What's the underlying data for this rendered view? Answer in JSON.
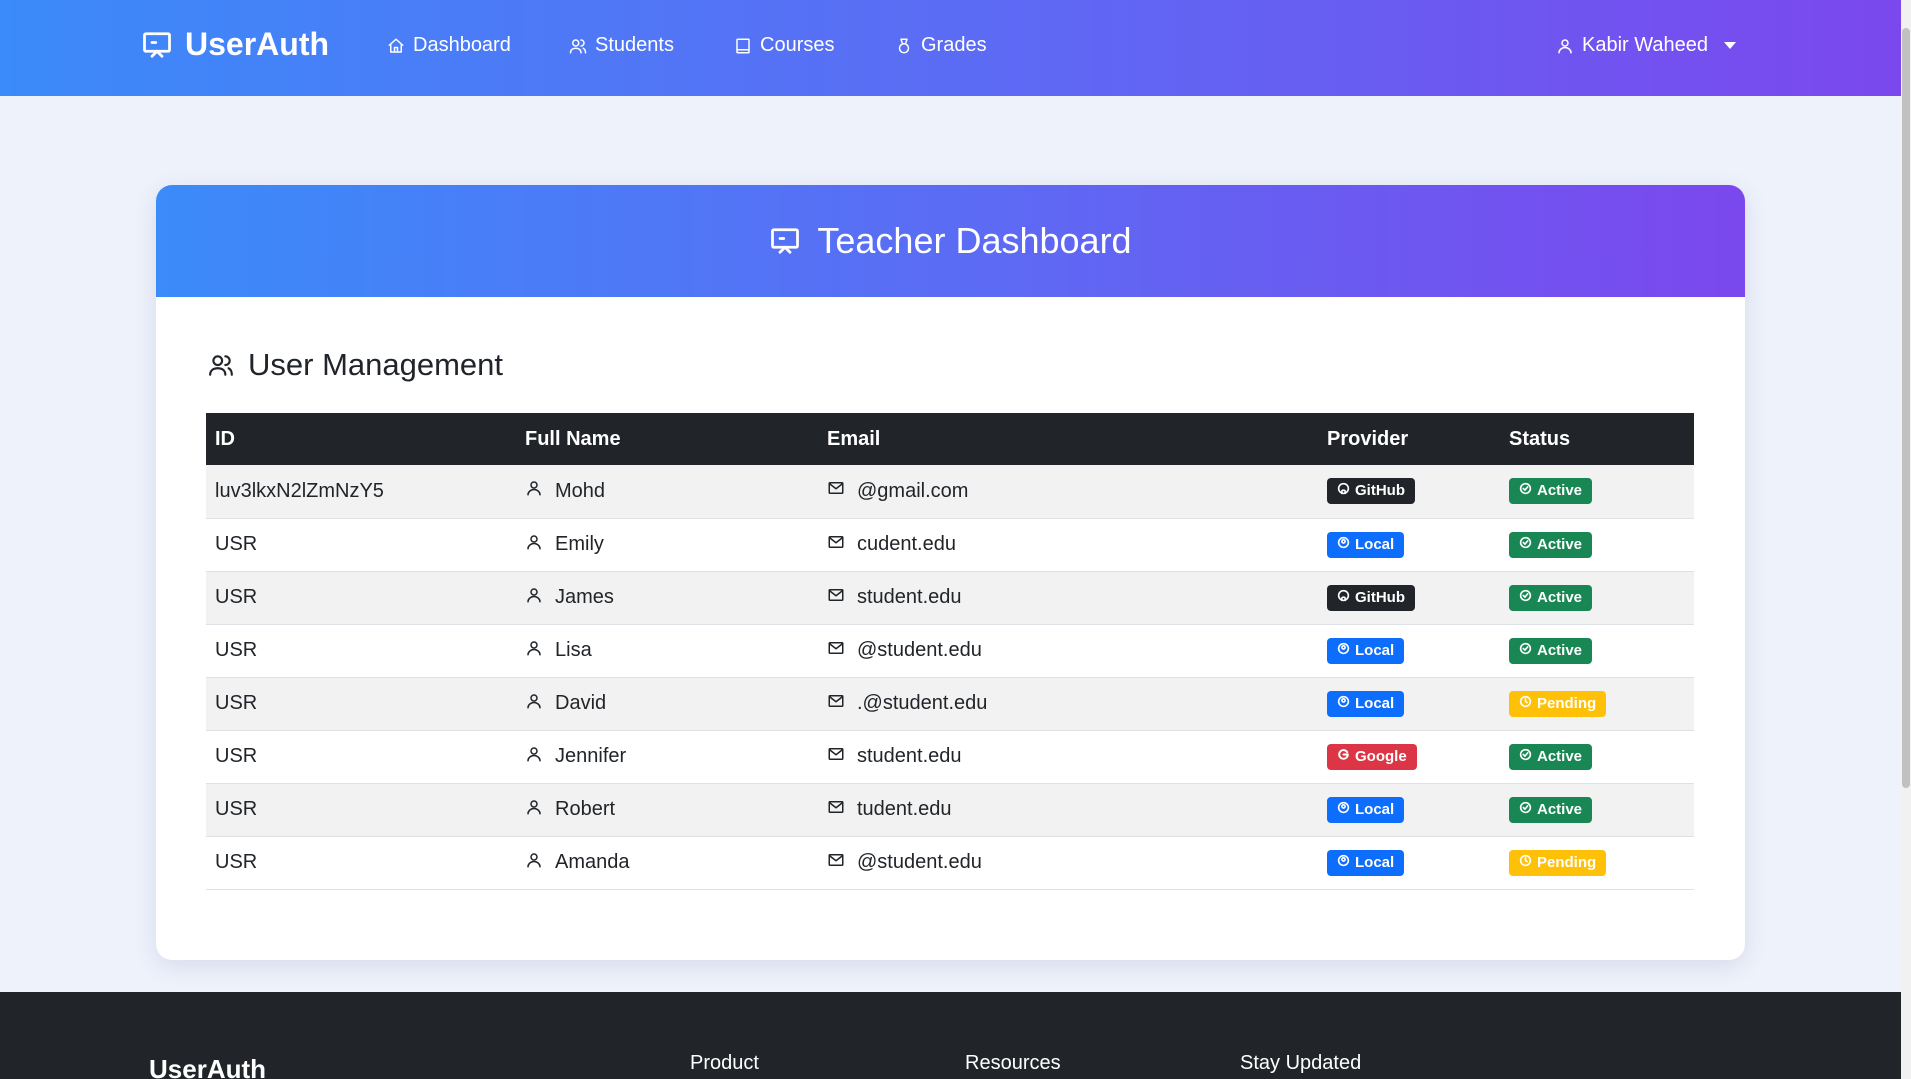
{
  "navbar": {
    "brand": "UserAuth",
    "links": [
      {
        "label": "Dashboard",
        "icon": "home-icon"
      },
      {
        "label": "Students",
        "icon": "users-icon"
      },
      {
        "label": "Courses",
        "icon": "book-icon"
      },
      {
        "label": "Grades",
        "icon": "medal-icon"
      }
    ],
    "user_name": "Kabir Waheed"
  },
  "card": {
    "title": "Teacher Dashboard",
    "section_title": "User Management"
  },
  "table": {
    "headers": [
      "ID",
      "Full Name",
      "Email",
      "Provider",
      "Status"
    ],
    "rows": [
      {
        "id": "luv3lkxN2lZmNzY5",
        "name": "Mohd",
        "email": "@gmail.com",
        "provider": "GitHub",
        "status": "Active"
      },
      {
        "id": "USR",
        "name": "Emily",
        "email": "cudent.edu",
        "provider": "Local",
        "status": "Active"
      },
      {
        "id": "USR",
        "name": "James",
        "email": "student.edu",
        "provider": "GitHub",
        "status": "Active"
      },
      {
        "id": "USR",
        "name": "Lisa",
        "email": "@student.edu",
        "provider": "Local",
        "status": "Active"
      },
      {
        "id": "USR",
        "name": "David",
        "email": ".@student.edu",
        "provider": "Local",
        "status": "Pending"
      },
      {
        "id": "USR",
        "name": "Jennifer",
        "email": "student.edu",
        "provider": "Google",
        "status": "Active"
      },
      {
        "id": "USR",
        "name": "Robert",
        "email": "tudent.edu",
        "provider": "Local",
        "status": "Active"
      },
      {
        "id": "USR",
        "name": "Amanda",
        "email": "@student.edu",
        "provider": "Local",
        "status": "Pending"
      }
    ]
  },
  "footer": {
    "brand": "UserAuth",
    "columns": [
      "Product",
      "Resources",
      "Stay Updated"
    ]
  },
  "colors": {
    "gradient_start": "#3b8bfa",
    "gradient_end": "#7b48ee",
    "github": "#212529",
    "local": "#0d6efd",
    "google": "#dc3545",
    "active": "#198754",
    "pending": "#ffc107"
  }
}
